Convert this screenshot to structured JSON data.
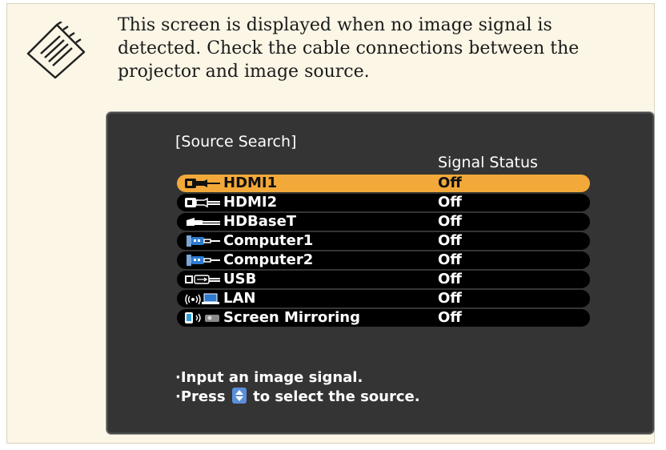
{
  "note": {
    "text": "This screen is displayed when no image signal is detected. Check the cable connections between the projector and image source."
  },
  "screen": {
    "title": "[Source Search]",
    "column_header": "Signal Status",
    "rows": [
      {
        "label": "HDMI1",
        "status": "Off",
        "icon": "hdmi-port-icon",
        "selected": true
      },
      {
        "label": "HDMI2",
        "status": "Off",
        "icon": "hdmi-port-icon",
        "selected": false
      },
      {
        "label": "HDBaseT",
        "status": "Off",
        "icon": "hdbaset-port-icon",
        "selected": false
      },
      {
        "label": "Computer1",
        "status": "Off",
        "icon": "vga-port-icon",
        "selected": false
      },
      {
        "label": "Computer2",
        "status": "Off",
        "icon": "vga-port-icon",
        "selected": false
      },
      {
        "label": "USB",
        "status": "Off",
        "icon": "usb-port-icon",
        "selected": false
      },
      {
        "label": "LAN",
        "status": "Off",
        "icon": "lan-wireless-icon",
        "selected": false
      },
      {
        "label": "Screen Mirroring",
        "status": "Off",
        "icon": "screen-mirroring-icon",
        "selected": false
      }
    ],
    "hint_1": "·Input an image signal.",
    "hint_2_prefix": "·Press",
    "hint_2_suffix": "to select the source."
  },
  "colors": {
    "selected_row": "#f2a93a",
    "screen_bg": "#343434",
    "note_bg": "#fbf6e6"
  }
}
